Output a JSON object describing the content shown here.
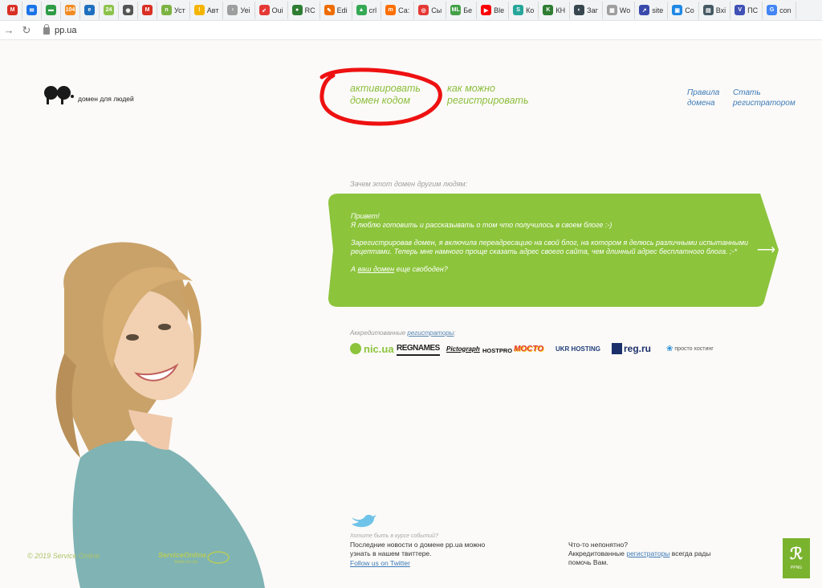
{
  "browser": {
    "bookmarks": [
      {
        "label": "",
        "icon": "gmail-icon",
        "color": "#d93025",
        "glyph": "M"
      },
      {
        "label": "",
        "icon": "mail-icon",
        "color": "#1a73e8",
        "glyph": "✉"
      },
      {
        "label": "",
        "icon": "inbox-icon",
        "color": "#2e9d46",
        "glyph": "▬"
      },
      {
        "label": "",
        "icon": "badge-104-icon",
        "color": "#f28b21",
        "glyph": "104"
      },
      {
        "label": "",
        "icon": "ie-icon",
        "color": "#1f6fbf",
        "glyph": "e"
      },
      {
        "label": "",
        "icon": "counter-24-icon",
        "color": "#8bc34a",
        "glyph": "24"
      },
      {
        "label": "",
        "icon": "globe-icon",
        "color": "#555555",
        "glyph": "◉"
      },
      {
        "label": "",
        "icon": "gmail-icon-2",
        "color": "#d93025",
        "glyph": "M"
      },
      {
        "label": "Уст",
        "icon": "n-icon",
        "color": "#7cb342",
        "glyph": "n"
      },
      {
        "label": "Авт",
        "icon": "bulb-icon",
        "color": "#f4b400",
        "glyph": "!"
      },
      {
        "label": "Уеі",
        "icon": "lamp-icon",
        "color": "#9e9e9e",
        "glyph": "♀"
      },
      {
        "label": "Oui",
        "icon": "bird-icon",
        "color": "#e53935",
        "glyph": "➶"
      },
      {
        "label": "RC",
        "icon": "rc-icon",
        "color": "#2e7d32",
        "glyph": "●"
      },
      {
        "label": "Edi",
        "icon": "edit-icon",
        "color": "#ef6c00",
        "glyph": "✎"
      },
      {
        "label": "crl",
        "icon": "drive-icon",
        "color": "#34a853",
        "glyph": "▲"
      },
      {
        "label": "Са:",
        "icon": "mi-icon",
        "color": "#ff6f00",
        "glyph": "m"
      },
      {
        "label": "Сы",
        "icon": "target-icon",
        "color": "#e53935",
        "glyph": "◎"
      },
      {
        "label": "Бе",
        "icon": "ml-icon",
        "color": "#43a047",
        "glyph": "ML"
      },
      {
        "label": "Ble",
        "icon": "youtube-icon",
        "color": "#ff0000",
        "glyph": "▶"
      },
      {
        "label": "Ко",
        "icon": "s-icon",
        "color": "#26a69a",
        "glyph": "S"
      },
      {
        "label": "КН",
        "icon": "kn-icon",
        "color": "#2e7d32",
        "glyph": "K"
      },
      {
        "label": "Заг",
        "icon": "eye-icon",
        "color": "#37474f",
        "glyph": "◐"
      },
      {
        "label": "Wo",
        "icon": "wo-icon",
        "color": "#9e9e9e",
        "glyph": "▦"
      },
      {
        "label": "site",
        "icon": "chart-icon",
        "color": "#3949ab",
        "glyph": "↗"
      },
      {
        "label": "Co",
        "icon": "co-icon",
        "color": "#1e88e5",
        "glyph": "▣"
      },
      {
        "label": "Вхі",
        "icon": "drive-box-icon",
        "color": "#455a64",
        "glyph": "▤"
      },
      {
        "label": "ПС",
        "icon": "v-icon",
        "color": "#3f51b5",
        "glyph": "V"
      },
      {
        "label": "con",
        "icon": "google-icon",
        "color": "#4285f4",
        "glyph": "G"
      }
    ],
    "url": "pp.ua"
  },
  "header": {
    "logo_text": "домен для людей",
    "activate_line1": "активировать",
    "activate_line2": "домен кодом",
    "howto_line1": "как можно",
    "howto_line2": "регистрировать",
    "rules_line1": "Правила",
    "rules_line2": "домена",
    "become_line1": "Стать",
    "become_line2": "регистратором"
  },
  "main": {
    "question": "Зачем этот домен другим людям:",
    "bubble_hello": "Привет!",
    "bubble_line1": "Я люблю готовить и рассказывать о том что получилось в своем блоге :-)",
    "bubble_para2": "Зарегистрировав домен, я включила переадресацию на свой блог, на котором я делюсь различными испытанными рецептами. Теперь мне намного проще сказать адрес своего сайта, чем длинный адрес бесплатного блога. ;-*",
    "bubble_ask_pre": "А ",
    "bubble_ask_link": "ваш домен",
    "bubble_ask_post": " еще свободен?",
    "bubble_color": "#8cc43c",
    "accredited_prefix": "Аккредитованные ",
    "accredited_link": "регистраторы",
    "accredited_suffix": ":",
    "registrars": [
      "nic.ua",
      "REGNAMES",
      "Pictograph",
      "HOSTPRO",
      "MOCTO",
      "UKR HOSTING",
      "reg.ru",
      "просто хостинг"
    ]
  },
  "footer": {
    "copyright": "© 2019 Service Online",
    "so_logo_title": "ServiceOnline",
    "so_logo_sub": "www.so.ua",
    "twitter_question": "Хотите быть в курсе событий?",
    "twitter_text": "Последние новости о домене pp.ua можно узнать в нашем твиттере.",
    "twitter_link": "Follow us on Twitter",
    "help_line1": "Что-то непонятно?",
    "help_prefix": "Аккредитованные ",
    "help_link": "регистраторы",
    "help_suffix": " всегда рады помочь Вам.",
    "badge_text": "PPNG",
    "badge_symbol": "ℛ"
  }
}
